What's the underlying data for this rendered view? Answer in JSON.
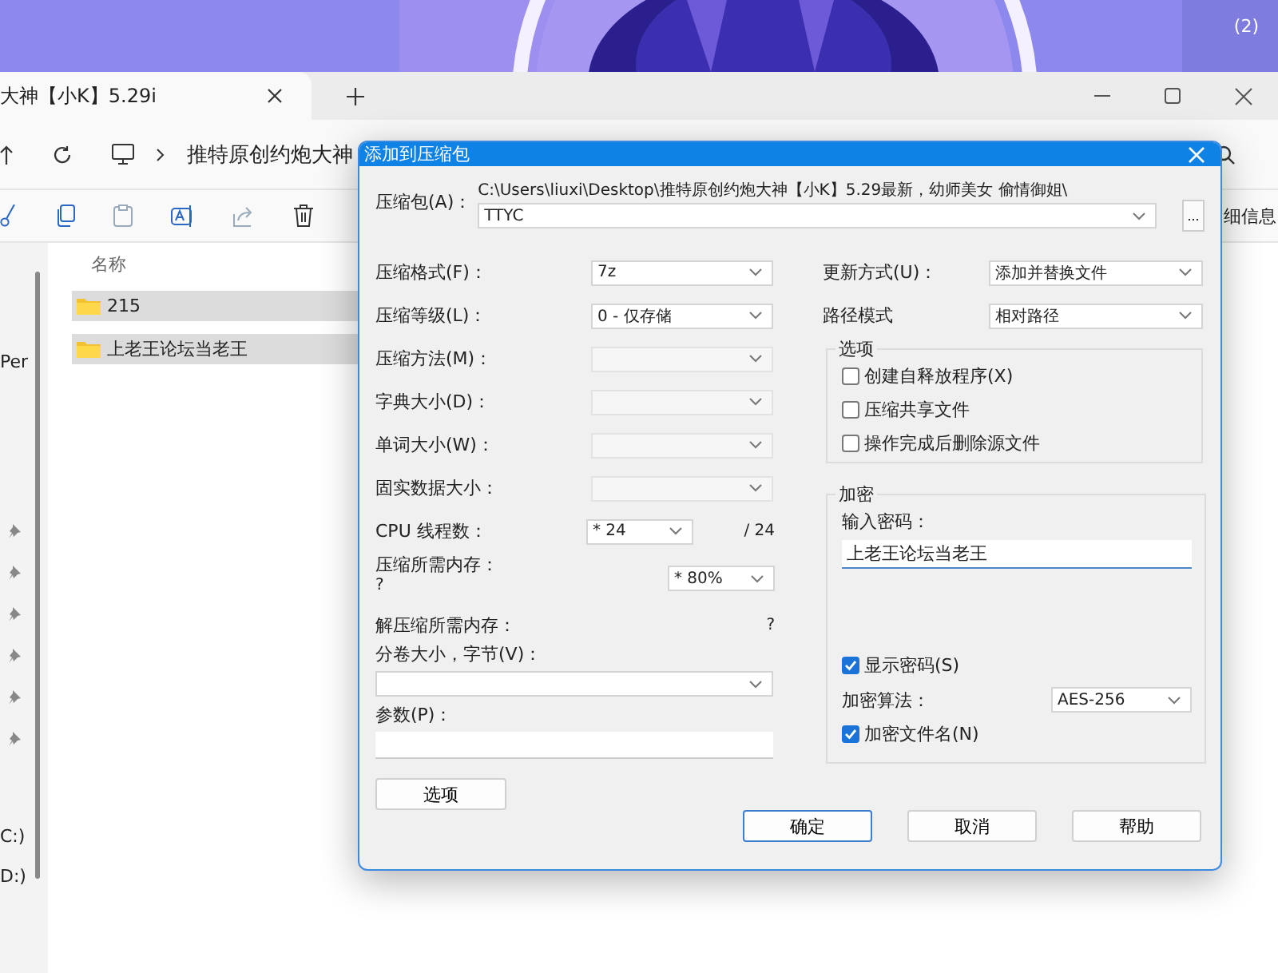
{
  "desktop": {
    "icon_label": "(2)"
  },
  "explorer": {
    "tab_title": "大神【小K】5.29i",
    "breadcrumb": "推特原创约炮大神",
    "toolbar_label": "细信息",
    "column_header": "名称",
    "sidebar": [
      "Per",
      "C:)",
      "D:)"
    ],
    "files": [
      {
        "name": "215",
        "selected": true
      },
      {
        "name": "上老王论坛当老王",
        "selected": true
      }
    ]
  },
  "dialog": {
    "title": "添加到压缩包",
    "archive_label": "压缩包(A)：",
    "archive_path": "C:\\Users\\liuxi\\Desktop\\推特原创约炮大神【小K】5.29最新，幼师美女 偷情御姐\\",
    "archive_name": "TTYC",
    "browse_button": "...",
    "left_rows": [
      {
        "kind": "select",
        "label": "压缩格式(F)：",
        "value": "7z",
        "disabled": false
      },
      {
        "kind": "select",
        "label": "压缩等级(L)：",
        "value": "0 - 仅存储",
        "disabled": false
      },
      {
        "kind": "select",
        "label": "压缩方法(M)：",
        "disabled": true
      },
      {
        "kind": "select",
        "label": "字典大小(D)：",
        "disabled": true
      },
      {
        "kind": "select",
        "label": "单词大小(W)：",
        "disabled": true
      },
      {
        "kind": "select",
        "label": "固实数据大小：",
        "disabled": true
      },
      {
        "kind": "cpu",
        "label": "CPU 线程数：",
        "value": "* 24",
        "total": "/ 24"
      },
      {
        "kind": "memory",
        "label": "压缩所需内存：",
        "note": "?",
        "value": "* 80%"
      },
      {
        "kind": "reading",
        "label": "解压缩所需内存：",
        "value": "?"
      },
      {
        "kind": "wide-select",
        "label": "分卷大小，字节(V)："
      },
      {
        "kind": "text",
        "label": "参数(P)："
      }
    ],
    "options_button": "选项",
    "update_mode": {
      "label": "更新方式(U)：",
      "value": "添加并替换文件"
    },
    "path_mode": {
      "label": "路径模式",
      "value": "相对路径"
    },
    "options_group": {
      "title": "选项",
      "checkboxes": [
        {
          "label": "创建自释放程序(X)",
          "checked": false
        },
        {
          "label": "压缩共享文件",
          "checked": false
        },
        {
          "label": "操作完成后删除源文件",
          "checked": false
        }
      ]
    },
    "encryption": {
      "title": "加密",
      "password_label": "输入密码：",
      "password_value": "上老王论坛当老王",
      "show_password": {
        "label": "显示密码(S)",
        "checked": true
      },
      "method_label": "加密算法：",
      "method_value": "AES-256",
      "encrypt_names": {
        "label": "加密文件名(N)",
        "checked": true
      }
    },
    "buttons": [
      {
        "label": "确定",
        "focused": true
      },
      {
        "label": "取消",
        "focused": false
      },
      {
        "label": "帮助",
        "focused": false
      }
    ]
  }
}
